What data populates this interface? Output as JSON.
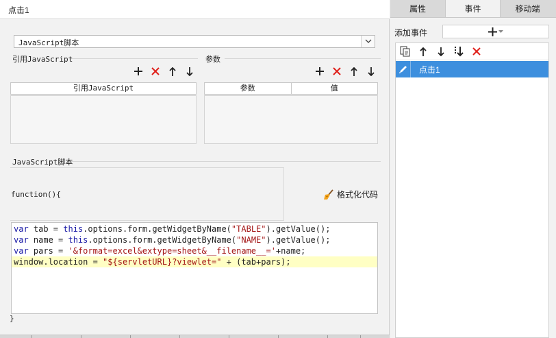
{
  "editor": {
    "title": "点击1",
    "script_type": "JavaScript脚本",
    "imports_section": {
      "label": "引用JavaScript",
      "column": "引用JavaScript"
    },
    "params_section": {
      "label": "参数",
      "columns": [
        "参数",
        "值"
      ]
    },
    "script_section": {
      "label": "JavaScript脚本",
      "function_open": "function(){",
      "format_button": "格式化代码",
      "function_close": "}"
    }
  },
  "code": {
    "lines": [
      [
        {
          "t": "var",
          "c": "kw"
        },
        {
          "t": " tab = "
        },
        {
          "t": "this",
          "c": "kw"
        },
        {
          "t": ".options.form.getWidgetByName("
        },
        {
          "t": "\"TABLE\"",
          "c": "str"
        },
        {
          "t": ").getValue();"
        }
      ],
      [
        {
          "t": "var",
          "c": "kw"
        },
        {
          "t": " name = "
        },
        {
          "t": "this",
          "c": "kw"
        },
        {
          "t": ".options.form.getWidgetByName("
        },
        {
          "t": "\"NAME\"",
          "c": "str"
        },
        {
          "t": ").getValue();"
        }
      ],
      [
        {
          "t": "var",
          "c": "kw"
        },
        {
          "t": " pars = "
        },
        {
          "t": "'&format=excel&extype=sheet&__filename__='",
          "c": "str"
        },
        {
          "t": "+name;"
        }
      ],
      [
        {
          "t": "window.location = "
        },
        {
          "t": "\"${servletURL}?viewlet=\"",
          "c": "str"
        },
        {
          "t": " + (tab+pars);"
        }
      ]
    ],
    "highlighted_line": 3
  },
  "right_panel": {
    "tabs": [
      "属性",
      "事件",
      "移动端"
    ],
    "active_tab": 1,
    "add_event_label": "添加事件",
    "events": [
      "点击1"
    ]
  },
  "colors": {
    "selection": "#3d8fde",
    "delete_red": "#e0201b",
    "keyword": "#1a1aa6",
    "string": "#a31515",
    "highlight_line": "#ffffc4"
  }
}
